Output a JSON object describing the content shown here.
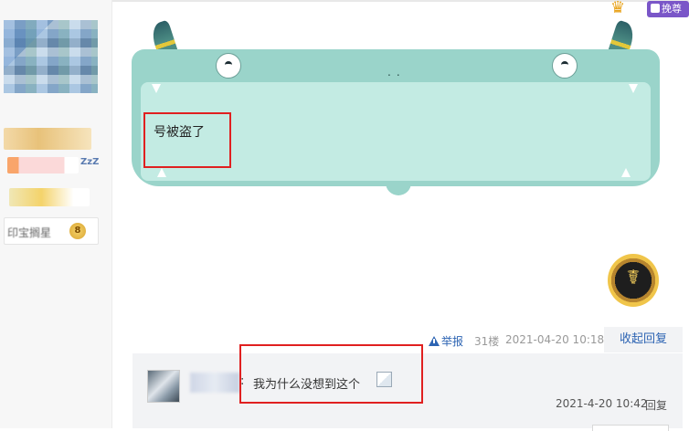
{
  "user": {
    "level": "8",
    "bar4_text": "印宝搁星",
    "zz": "ZzZ"
  },
  "vip": {
    "crown": "♛",
    "label": "挽尊"
  },
  "post": {
    "text": "号被盗了",
    "nose": "..",
    "report_label": "举报",
    "floor": "31楼",
    "time": "2021-04-20 10:18",
    "collapse_label": "收起回复"
  },
  "medal": {
    "symbol": "☤"
  },
  "reply": {
    "colon": ":",
    "text": "我为什么没想到这个",
    "time": "2021-4-20 10:42",
    "reply_label": "回复"
  },
  "colors": {
    "link": "#2d64b3",
    "highlight": "#e02020",
    "monster": "#9ad4ca",
    "bubble": "#c3ebe3"
  }
}
